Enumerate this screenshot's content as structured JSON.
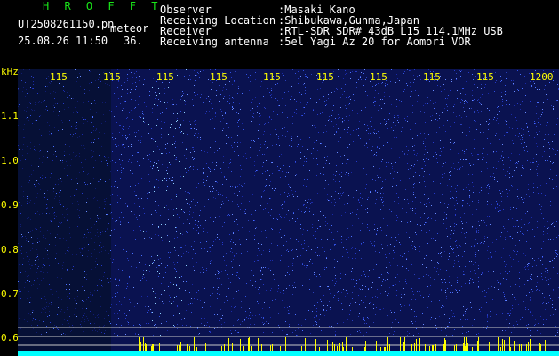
{
  "header": {
    "title": "H R O F F T",
    "filename": "UT2508261150.pn",
    "tag": "meteor",
    "datetime": "25.08.26 11:50",
    "number": "36.",
    "fields": [
      {
        "label": "Observer",
        "value": ":Masaki Kano"
      },
      {
        "label": "Receiving Location",
        "value": ":Shibukawa,Gunma,Japan"
      },
      {
        "label": "Receiver",
        "value": ":RTL-SDR SDR# 43dB L15 114.1MHz USB"
      },
      {
        "label": "Receiving antenna",
        "value": ":5el Yagi Az 20 for Aomori VOR"
      }
    ]
  },
  "axes": {
    "y_unit": "kHz",
    "y_ticks": [
      "1.1",
      "1.0",
      "0.9",
      "0.8",
      "0.7",
      "0.6"
    ],
    "x_ticks": [
      "115",
      "115",
      "115",
      "115",
      "115",
      "115",
      "115",
      "115",
      "115",
      "1200"
    ]
  },
  "colors": {
    "background": "#000000",
    "title": "#19e619",
    "text": "#ffffff",
    "axis": "#ffff00",
    "noise": "#1a2aa8",
    "signal": "#00ffff"
  }
}
